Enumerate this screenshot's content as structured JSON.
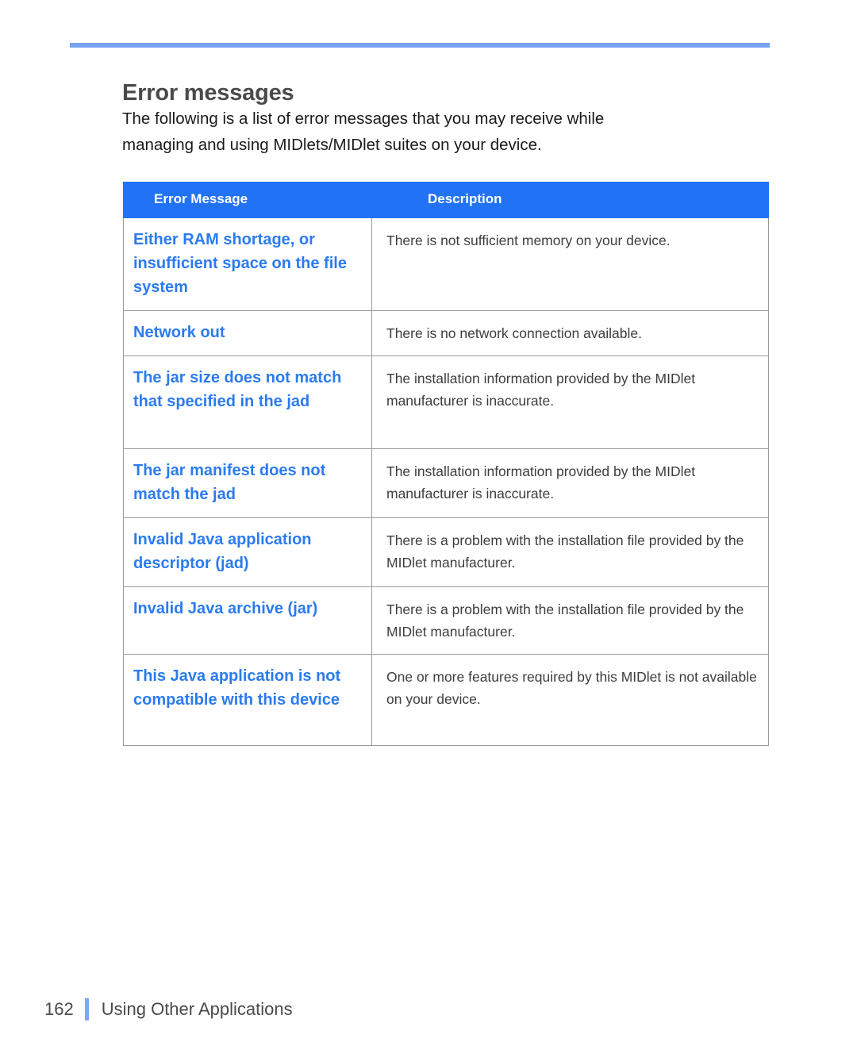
{
  "document": {
    "heading": "Error messages",
    "intro_lines": [
      "The following is a list of error messages that you may receive while",
      "managing and using MIDlets/MIDlet suites on your device."
    ]
  },
  "colors": {
    "rule": "#76a3f3",
    "table_header_bg": "#2272f5",
    "table_header_text": "#ffffff",
    "error_message_text": "#2b7bf0",
    "description_text": "#3d3d3d",
    "heading_text": "#4a4a4a",
    "footer_bar": "#7ba7f5",
    "cell_border": "#9a9a9a"
  },
  "table": {
    "columns": [
      "Error Message",
      "Description"
    ],
    "rows": [
      {
        "message": "Either RAM shortage, or insufficient space on the file system",
        "description": "There is not sufficient memory on your device."
      },
      {
        "message": "Network out",
        "description": "There is no network connection available."
      },
      {
        "message": "The jar size does not match that specified in the jad",
        "description": "The installation information provided by the MIDlet manufacturer is inaccurate."
      },
      {
        "message": "The jar manifest does not match the jad",
        "description": "The installation information provided by the MIDlet manufacturer is inaccurate."
      },
      {
        "message": "Invalid Java application descriptor (jad)",
        "description": "There is a problem with the installation file provided by the MIDlet manufacturer."
      },
      {
        "message": "Invalid Java archive (jar)",
        "description": "There is a problem with the installation file provided by the MIDlet manufacturer."
      },
      {
        "message": "This Java application is not compatible with this device",
        "description": "One or more features required by this MIDlet is not available on your device."
      }
    ]
  },
  "footer": {
    "page_number": "162",
    "section": "Using Other Applications"
  }
}
